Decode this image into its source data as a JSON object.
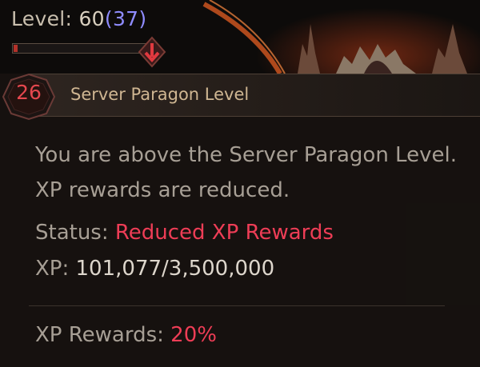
{
  "top": {
    "level_label": "Level:",
    "level_value": "60",
    "paragon_value": "(37)",
    "xp_progress_fraction": 0.03,
    "arrow_icon": "down-arrow-icon"
  },
  "tooltip": {
    "badge_value": "26",
    "title": "Server Paragon Level",
    "description": "You are above the Server Paragon Level. XP rewards are reduced.",
    "status_label": "Status:",
    "status_value": "Reduced XP Rewards",
    "xp_label": "XP:",
    "xp_value": "101,077/3,500,000",
    "rewards_label": "XP Rewards:",
    "rewards_value": "20%"
  },
  "colors": {
    "accent_red": "#ee3d56",
    "paragon_blue": "#8f8cff",
    "title_gold": "#cfb692",
    "body_text": "#a79f95"
  }
}
